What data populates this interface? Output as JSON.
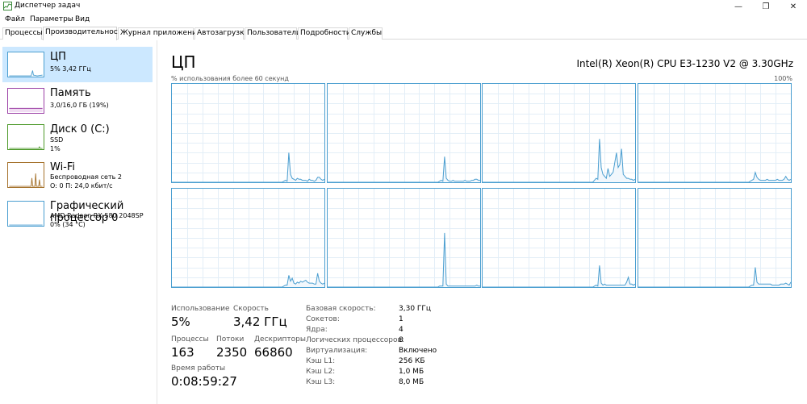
{
  "window": {
    "title": "Диспетчер задач",
    "controls": {
      "minimize": "—",
      "maximize": "❐",
      "close": "✕"
    }
  },
  "menu": [
    "Файл",
    "Параметры",
    "Вид"
  ],
  "tabs": [
    {
      "label": "Процессы",
      "active": false
    },
    {
      "label": "Производительность",
      "active": true
    },
    {
      "label": "Журнал приложений",
      "active": false
    },
    {
      "label": "Автозагрузка",
      "active": false
    },
    {
      "label": "Пользователи",
      "active": false
    },
    {
      "label": "Подробности",
      "active": false
    },
    {
      "label": "Службы",
      "active": false
    }
  ],
  "sidebar": {
    "items": [
      {
        "title": "ЦП",
        "line1": "5% 3,42 ГГц",
        "line2": "",
        "color": "#4a9ed0",
        "selected": true
      },
      {
        "title": "Память",
        "line1": "3,0/16,0 ГБ (19%)",
        "line2": "",
        "color": "#9b3fa5",
        "selected": false
      },
      {
        "title": "Диск 0 (C:)",
        "line1": "SSD",
        "line2": "1%",
        "color": "#4e9a2b",
        "selected": false
      },
      {
        "title": "Wi-Fi",
        "line1": "Беспроводная сеть 2",
        "line2": "О: 0 П: 24,0 кбит/с",
        "color": "#a5722c",
        "selected": false
      },
      {
        "title": "Графический процессор 0",
        "line1": "AMD Radeon RX 580 2048SP",
        "line2": "0% (34 °C)",
        "color": "#4a9ed0",
        "selected": false
      }
    ]
  },
  "main": {
    "title": "ЦП",
    "cpu_model": "Intel(R) Xeon(R) CPU E3-1230 V2 @ 3.30GHz",
    "graph_label": "% использования более 60 секунд",
    "graph_max": "100%",
    "graph_color": "#4a9ed0",
    "stats": {
      "usage_label": "Использование",
      "usage_value": "5%",
      "speed_label": "Скорость",
      "speed_value": "3,42 ГГц",
      "processes_label": "Процессы",
      "processes_value": "163",
      "threads_label": "Потоки",
      "threads_value": "2350",
      "handles_label": "Дескрипторы",
      "handles_value": "66860",
      "uptime_label": "Время работы",
      "uptime_value": "0:08:59:27"
    },
    "details": [
      {
        "label": "Базовая скорость:",
        "value": "3,30 ГГц"
      },
      {
        "label": "Сокетов:",
        "value": "1"
      },
      {
        "label": "Ядра:",
        "value": "4"
      },
      {
        "label": "Логических процессоров:",
        "value": "8"
      },
      {
        "label": "Виртуализация:",
        "value": "Включено"
      },
      {
        "label": "Кэш L1:",
        "value": "256 КБ"
      },
      {
        "label": "Кэш L2:",
        "value": "1,0 МБ"
      },
      {
        "label": "Кэш L3:",
        "value": "8,0 МБ"
      }
    ]
  },
  "chart_data": {
    "type": "line",
    "ylim": [
      0,
      100
    ],
    "series": [
      {
        "values": [
          0,
          0,
          0,
          0,
          0,
          0,
          0,
          0,
          0,
          0,
          0,
          0,
          0,
          0,
          0,
          0,
          0,
          0,
          0,
          0,
          0,
          0,
          0,
          0,
          0,
          0,
          0,
          0,
          0,
          0,
          0,
          0,
          0,
          0,
          0,
          0,
          0,
          0,
          0,
          0,
          0,
          0,
          0,
          0,
          0,
          0,
          0,
          0,
          0,
          0,
          0,
          0,
          0,
          0,
          0,
          0,
          0,
          0,
          0,
          0,
          0,
          0,
          0,
          0,
          0,
          0,
          1,
          2,
          1,
          30,
          8,
          4,
          3,
          2,
          4,
          3,
          3,
          2,
          2,
          2,
          1,
          3,
          2,
          2,
          1,
          2,
          5,
          5,
          3,
          2,
          3
        ]
      },
      {
        "values": [
          0,
          0,
          0,
          0,
          0,
          0,
          0,
          0,
          0,
          0,
          0,
          0,
          0,
          0,
          0,
          0,
          0,
          0,
          0,
          0,
          0,
          0,
          0,
          0,
          0,
          0,
          0,
          0,
          0,
          0,
          0,
          0,
          0,
          0,
          0,
          0,
          0,
          0,
          0,
          0,
          0,
          0,
          0,
          0,
          0,
          0,
          0,
          0,
          0,
          0,
          0,
          0,
          0,
          0,
          0,
          0,
          0,
          0,
          0,
          0,
          0,
          0,
          0,
          0,
          0,
          0,
          1,
          2,
          1,
          26,
          4,
          2,
          1,
          1,
          2,
          1,
          1,
          1,
          1,
          1,
          1,
          2,
          1,
          1,
          1,
          2,
          2,
          3,
          3,
          2,
          2
        ]
      },
      {
        "values": [
          0,
          0,
          0,
          0,
          0,
          0,
          0,
          0,
          0,
          0,
          0,
          0,
          0,
          0,
          0,
          0,
          0,
          0,
          0,
          0,
          0,
          0,
          0,
          0,
          0,
          0,
          0,
          0,
          0,
          0,
          0,
          0,
          0,
          0,
          0,
          0,
          0,
          0,
          0,
          0,
          0,
          0,
          0,
          0,
          0,
          0,
          0,
          0,
          0,
          0,
          0,
          0,
          0,
          0,
          0,
          0,
          0,
          0,
          0,
          0,
          0,
          0,
          0,
          0,
          0,
          0,
          2,
          4,
          3,
          44,
          15,
          8,
          6,
          4,
          14,
          6,
          8,
          10,
          20,
          30,
          15,
          18,
          34,
          8,
          6,
          4,
          4,
          3,
          3,
          2,
          3
        ]
      },
      {
        "values": [
          0,
          0,
          0,
          0,
          0,
          0,
          0,
          0,
          0,
          0,
          0,
          0,
          0,
          0,
          0,
          0,
          0,
          0,
          0,
          0,
          0,
          0,
          0,
          0,
          0,
          0,
          0,
          0,
          0,
          0,
          0,
          0,
          0,
          0,
          0,
          0,
          0,
          0,
          0,
          0,
          0,
          0,
          0,
          0,
          0,
          0,
          0,
          0,
          0,
          0,
          0,
          0,
          0,
          0,
          0,
          0,
          0,
          0,
          0,
          0,
          0,
          0,
          0,
          0,
          0,
          0,
          1,
          2,
          3,
          10,
          5,
          3,
          2,
          2,
          2,
          2,
          3,
          2,
          2,
          2,
          2,
          2,
          3,
          2,
          2,
          2,
          3,
          6,
          3,
          2,
          3
        ]
      },
      {
        "values": [
          0,
          0,
          0,
          0,
          0,
          0,
          0,
          0,
          0,
          0,
          0,
          0,
          0,
          0,
          0,
          0,
          0,
          0,
          0,
          0,
          0,
          0,
          0,
          0,
          0,
          0,
          0,
          0,
          0,
          0,
          0,
          0,
          0,
          0,
          0,
          0,
          0,
          0,
          0,
          0,
          0,
          0,
          0,
          0,
          0,
          0,
          0,
          0,
          0,
          0,
          0,
          0,
          0,
          0,
          0,
          0,
          0,
          0,
          0,
          0,
          0,
          0,
          0,
          0,
          0,
          0,
          1,
          2,
          2,
          12,
          6,
          9,
          4,
          3,
          5,
          4,
          6,
          5,
          6,
          7,
          5,
          4,
          4,
          4,
          3,
          3,
          14,
          6,
          4,
          3,
          4
        ]
      },
      {
        "values": [
          0,
          0,
          0,
          0,
          0,
          0,
          0,
          0,
          0,
          0,
          0,
          0,
          0,
          0,
          0,
          0,
          0,
          0,
          0,
          0,
          0,
          0,
          0,
          0,
          0,
          0,
          0,
          0,
          0,
          0,
          0,
          0,
          0,
          0,
          0,
          0,
          0,
          0,
          0,
          0,
          0,
          0,
          0,
          0,
          0,
          0,
          0,
          0,
          0,
          0,
          0,
          0,
          0,
          0,
          0,
          0,
          0,
          0,
          0,
          0,
          0,
          0,
          0,
          0,
          0,
          0,
          1,
          1,
          1,
          55,
          3,
          1,
          1,
          1,
          1,
          1,
          1,
          1,
          1,
          1,
          1,
          1,
          1,
          1,
          1,
          1,
          1,
          1,
          2,
          1,
          1
        ]
      },
      {
        "values": [
          0,
          0,
          0,
          0,
          0,
          0,
          0,
          0,
          0,
          0,
          0,
          0,
          0,
          0,
          0,
          0,
          0,
          0,
          0,
          0,
          0,
          0,
          0,
          0,
          0,
          0,
          0,
          0,
          0,
          0,
          0,
          0,
          0,
          0,
          0,
          0,
          0,
          0,
          0,
          0,
          0,
          0,
          0,
          0,
          0,
          0,
          0,
          0,
          0,
          0,
          0,
          0,
          0,
          0,
          0,
          0,
          0,
          0,
          0,
          0,
          0,
          0,
          0,
          0,
          0,
          0,
          1,
          2,
          1,
          22,
          4,
          2,
          3,
          2,
          2,
          2,
          2,
          2,
          2,
          2,
          2,
          2,
          2,
          2,
          2,
          5,
          10,
          3,
          3,
          2,
          3
        ]
      },
      {
        "values": [
          0,
          0,
          0,
          0,
          0,
          0,
          0,
          0,
          0,
          0,
          0,
          0,
          0,
          0,
          0,
          0,
          0,
          0,
          0,
          0,
          0,
          0,
          0,
          0,
          0,
          0,
          0,
          0,
          0,
          0,
          0,
          0,
          0,
          0,
          0,
          0,
          0,
          0,
          0,
          0,
          0,
          0,
          0,
          0,
          0,
          0,
          0,
          0,
          0,
          0,
          0,
          0,
          0,
          0,
          0,
          0,
          0,
          0,
          0,
          0,
          0,
          0,
          0,
          0,
          0,
          0,
          1,
          2,
          2,
          20,
          5,
          3,
          3,
          3,
          3,
          3,
          3,
          3,
          3,
          2,
          2,
          2,
          2,
          2,
          3,
          3,
          3,
          4,
          3,
          2,
          5
        ]
      }
    ]
  }
}
